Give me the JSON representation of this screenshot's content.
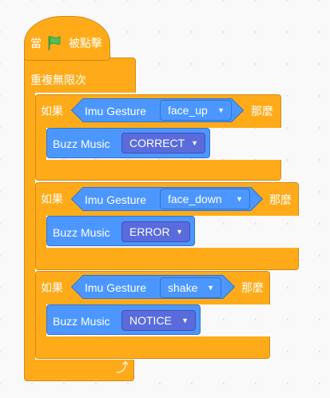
{
  "hat": {
    "label_when": "當",
    "flag_icon": "green-flag",
    "label_clicked": "被點擊"
  },
  "loop": {
    "label": "重複無限次"
  },
  "if_blocks": [
    {
      "if_label": "如果",
      "then_label": "那麼",
      "sensor_label": "Imu Gesture",
      "gesture": "face_up",
      "action_label": "Buzz Music",
      "music": "CORRECT"
    },
    {
      "if_label": "如果",
      "then_label": "那麼",
      "sensor_label": "Imu Gesture",
      "gesture": "face_down",
      "action_label": "Buzz Music",
      "music": "ERROR"
    },
    {
      "if_label": "如果",
      "then_label": "那麼",
      "sensor_label": "Imu Gesture",
      "gesture": "shake",
      "action_label": "Buzz Music",
      "music": "NOTICE"
    }
  ],
  "loop_icon": "loop-arrow-icon",
  "colors": {
    "control": "#ffab19",
    "sensor": "#4c97ff",
    "menu": "#5a6bdc",
    "background": "#f9f9f9"
  }
}
